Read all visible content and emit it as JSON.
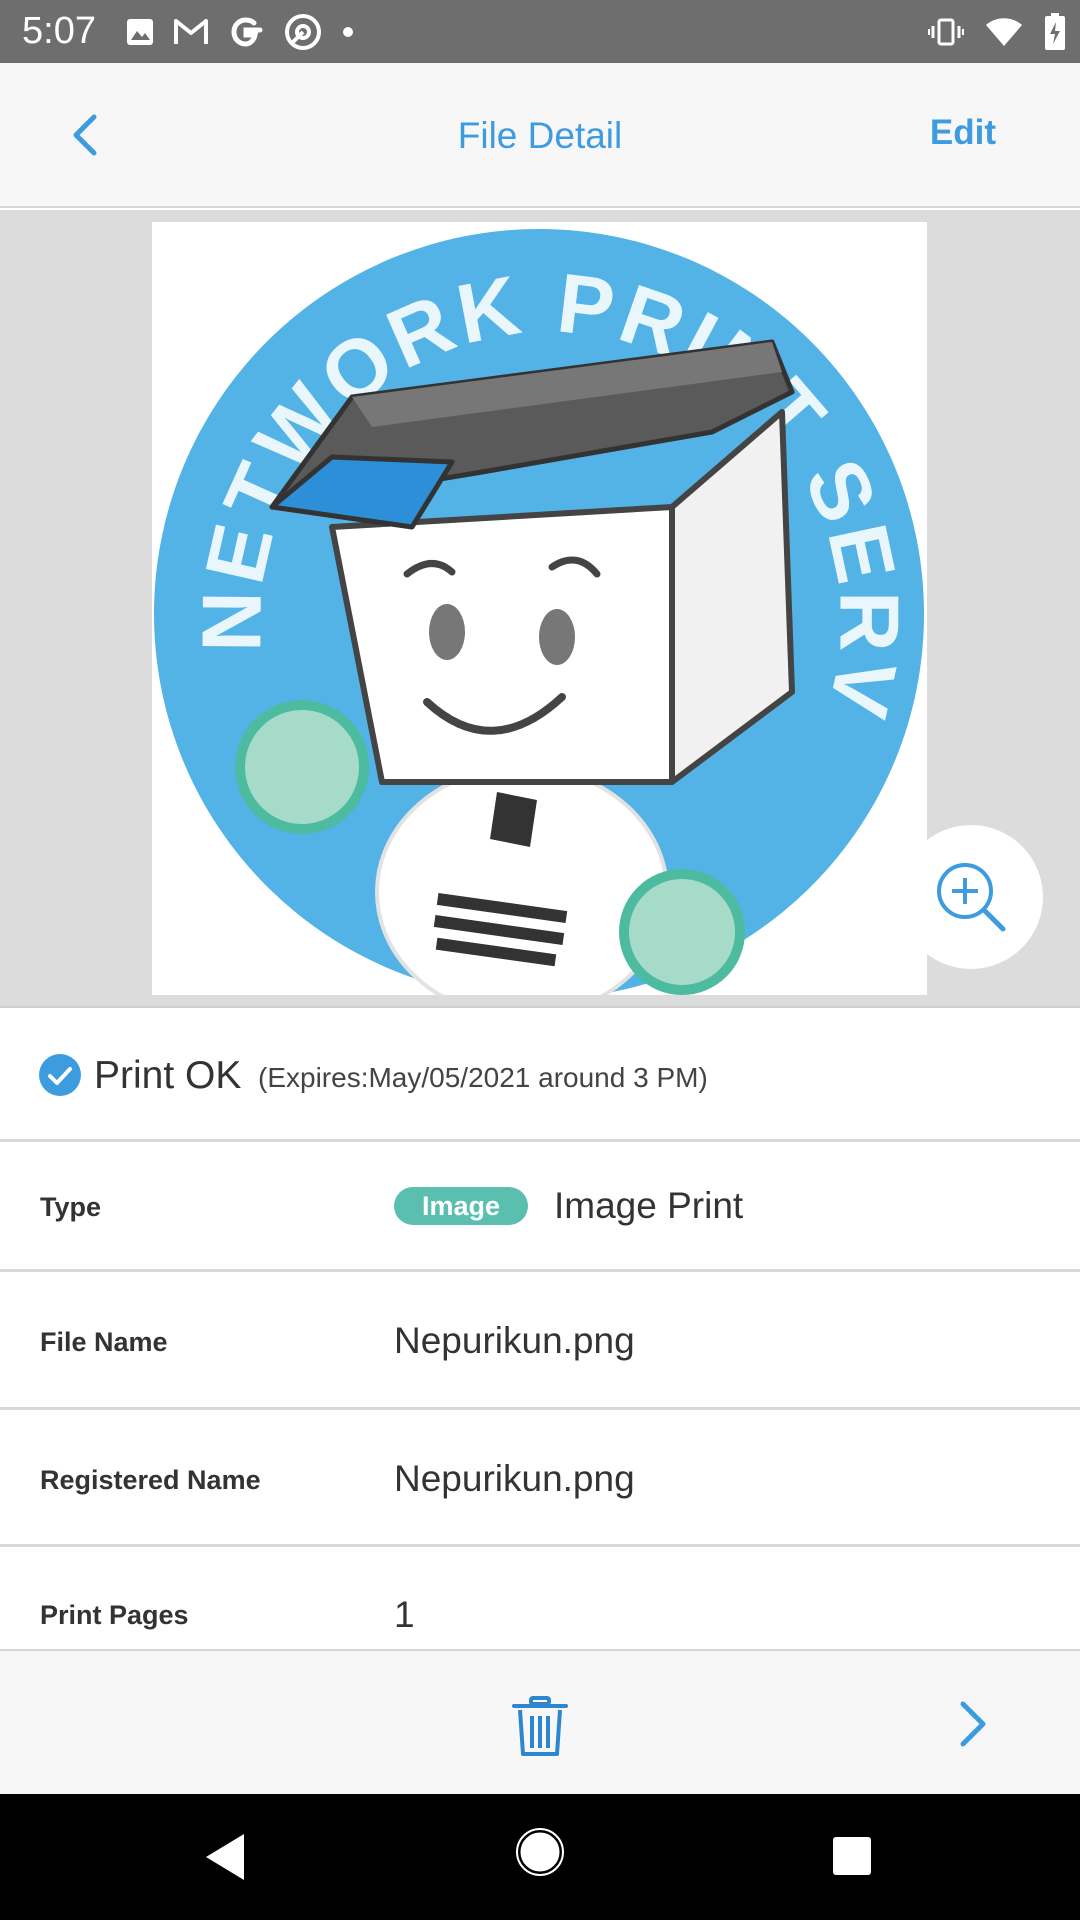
{
  "status_bar": {
    "time": "5:07",
    "left_icons": [
      "image-icon",
      "gmail-icon",
      "google-icon",
      "at-sign-icon",
      "dot-icon"
    ],
    "right_icons": [
      "vibrate-icon",
      "wifi-icon",
      "battery-charging-icon"
    ]
  },
  "header": {
    "title": "File Detail",
    "edit_label": "Edit"
  },
  "preview": {
    "image_text": "NETWORK PRINT SERVICE"
  },
  "print_status": {
    "label": "Print OK",
    "expires": "(Expires:May/05/2021 around 3 PM)"
  },
  "details": [
    {
      "label": "Type",
      "badge": "Image",
      "value": "Image Print"
    },
    {
      "label": "File Name",
      "value": "Nepurikun.png"
    },
    {
      "label": "Registered Name",
      "value": "Nepurikun.png"
    },
    {
      "label": "Print Pages",
      "value": "1"
    }
  ],
  "colors": {
    "accent": "#3d9be0",
    "badge": "#5bbfb0",
    "status_bar": "#6e6e6e"
  }
}
